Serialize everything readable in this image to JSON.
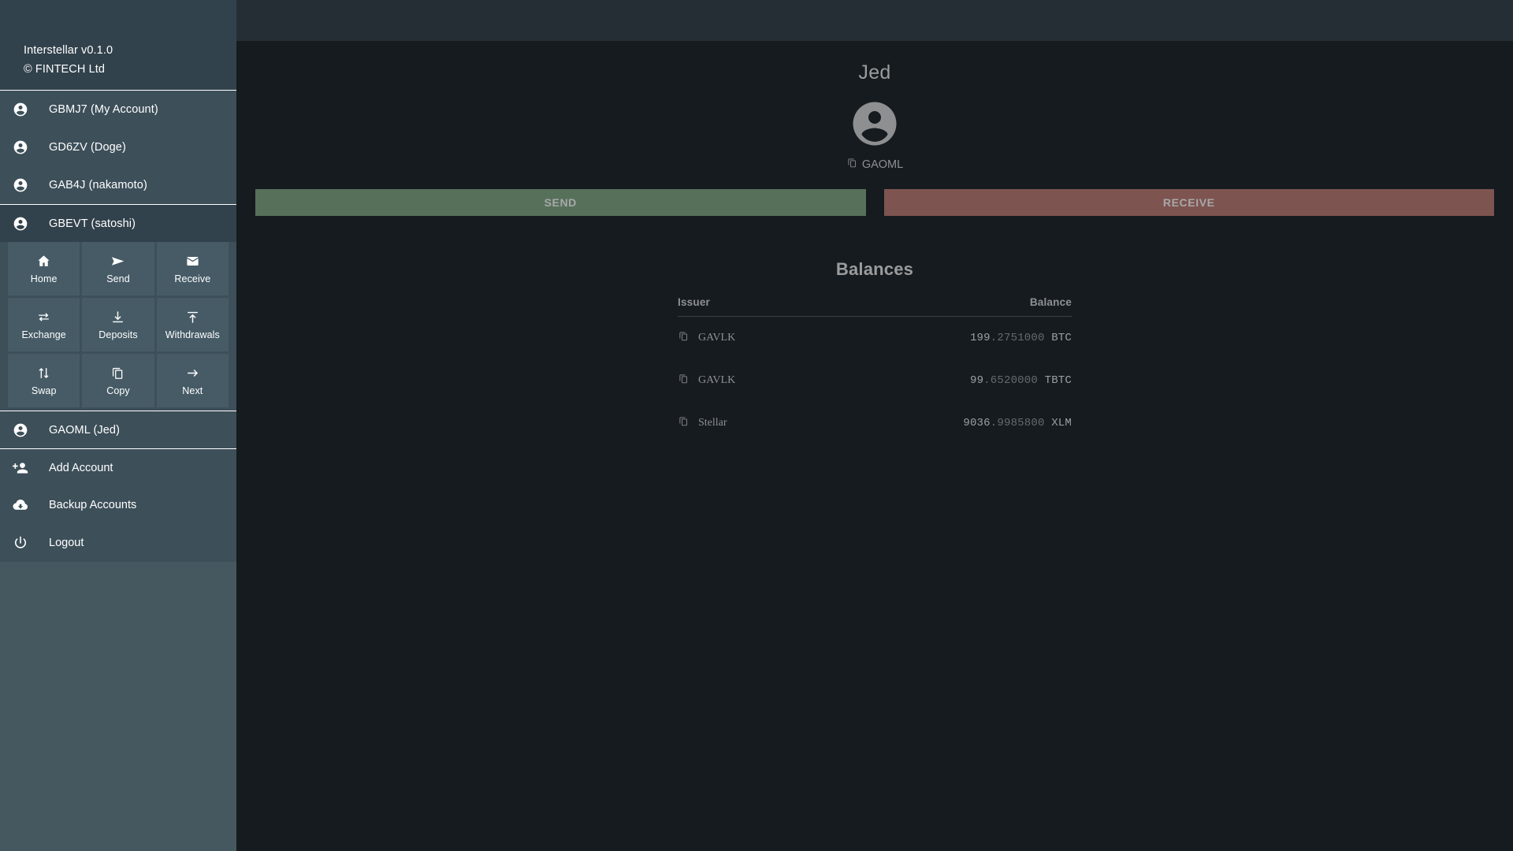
{
  "sidebar": {
    "header": {
      "app_title": "Interstellar v0.1.0",
      "copyright": "© FINTECH Ltd"
    },
    "accounts": [
      {
        "label": "GBMJ7 (My Account)",
        "icon": "account-circle-icon"
      },
      {
        "label": "GD6ZV (Doge)",
        "icon": "account-circle-icon"
      },
      {
        "label": "GAB4J (nakamoto)",
        "icon": "account-circle-icon"
      }
    ],
    "selected_account": {
      "label": "GBEVT (satoshi)",
      "icon": "account-circle-icon"
    },
    "actions": [
      {
        "label": "Home",
        "icon": "home-icon"
      },
      {
        "label": "Send",
        "icon": "send-icon"
      },
      {
        "label": "Receive",
        "icon": "envelope-icon"
      },
      {
        "label": "Exchange",
        "icon": "exchange-arrows-icon"
      },
      {
        "label": "Deposits",
        "icon": "download-arrow-icon"
      },
      {
        "label": "Withdrawals",
        "icon": "upload-arrow-icon"
      },
      {
        "label": "Swap",
        "icon": "swap-vertical-icon"
      },
      {
        "label": "Copy",
        "icon": "copy-icon"
      },
      {
        "label": "Next",
        "icon": "arrow-right-icon"
      }
    ],
    "account_after_grid": {
      "label": "GAOML (Jed)",
      "icon": "account-circle-icon"
    },
    "menu": [
      {
        "label": "Add Account",
        "icon": "person-add-icon"
      },
      {
        "label": "Backup Accounts",
        "icon": "cloud-download-icon"
      },
      {
        "label": "Logout",
        "icon": "power-icon"
      }
    ]
  },
  "main": {
    "profile": {
      "name": "Jed",
      "avatar_icon": "avatar-person-icon",
      "address": "GAOML",
      "address_copy_icon": "copy-icon"
    },
    "buttons": {
      "send_label": "SEND",
      "receive_label": "RECEIVE",
      "send_color": "#56705a",
      "receive_color": "#7d5450"
    },
    "balances": {
      "title": "Balances",
      "columns": {
        "issuer": "Issuer",
        "balance": "Balance"
      },
      "rows": [
        {
          "issuer": "GAVLK",
          "copy_icon": "copy-icon",
          "amount_int": "199",
          "amount_dec": ".2751000",
          "asset": "BTC"
        },
        {
          "issuer": "GAVLK",
          "copy_icon": "copy-icon",
          "amount_int": "99",
          "amount_dec": ".6520000",
          "asset": "TBTC"
        },
        {
          "issuer": "Stellar",
          "copy_icon": "copy-icon",
          "amount_int": "9036",
          "amount_dec": ".9985800",
          "asset": "XLM"
        }
      ]
    }
  },
  "colors": {
    "sidebar_bg": "#3d4f59",
    "sidebar_header_bg": "#32424c",
    "main_bg": "#161b1f",
    "topbar_bg": "#262e35",
    "tile_bg": "#465b66"
  }
}
